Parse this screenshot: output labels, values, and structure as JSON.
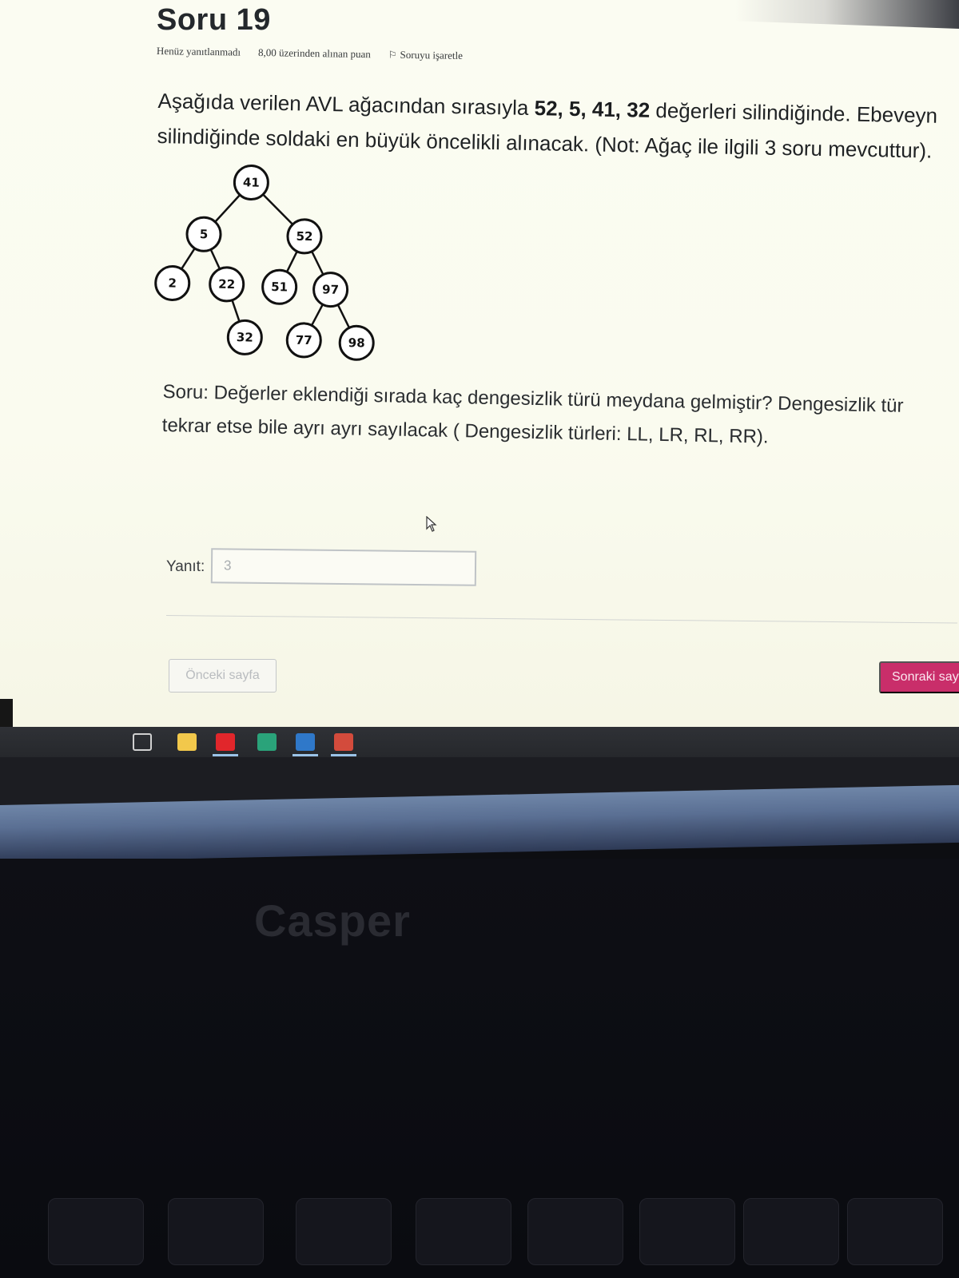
{
  "question": {
    "title": "Soru 19",
    "status": "Henüz yanıtlanmadı",
    "points": "8,00 üzerinden alınan puan",
    "flag_label": "Soruyu işaretle",
    "text_prefix": "Aşağıda verilen AVL ağacından sırasıyla ",
    "text_values": "52, 5, 41, 32",
    "text_suffix": " değerleri silindiğinde. Ebeveyn ",
    "text_line2": "silindiğinde soldaki en büyük öncelikli alınacak. (Not: Ağaç ile ilgili 3 soru mevcuttur).",
    "sub_question_line1": "Soru: Değerler eklendiği sırada kaç dengesizlik türü meydana gelmiştir? Dengesizlik tür",
    "sub_question_line2": "tekrar etse bile ayrı ayrı sayılacak ( Dengesizlik türleri: LL, LR, RL, RR)."
  },
  "tree": {
    "nodes": [
      "41",
      "5",
      "52",
      "2",
      "22",
      "51",
      "97",
      "32",
      "77",
      "98"
    ]
  },
  "answer": {
    "label": "Yanıt:",
    "value": "3"
  },
  "navigation": {
    "prev_label": "Önceki sayfa",
    "next_label": "Sonraki sayfa"
  },
  "taskbar": {
    "icons": [
      "task-view-icon",
      "file-explorer-icon",
      "opera-icon",
      "app-icon",
      "app-icon",
      "app-icon"
    ]
  },
  "device": {
    "brand": "Casper"
  },
  "colors": {
    "next_button": "#c92e6a",
    "page_background": "#fbfcf2"
  }
}
